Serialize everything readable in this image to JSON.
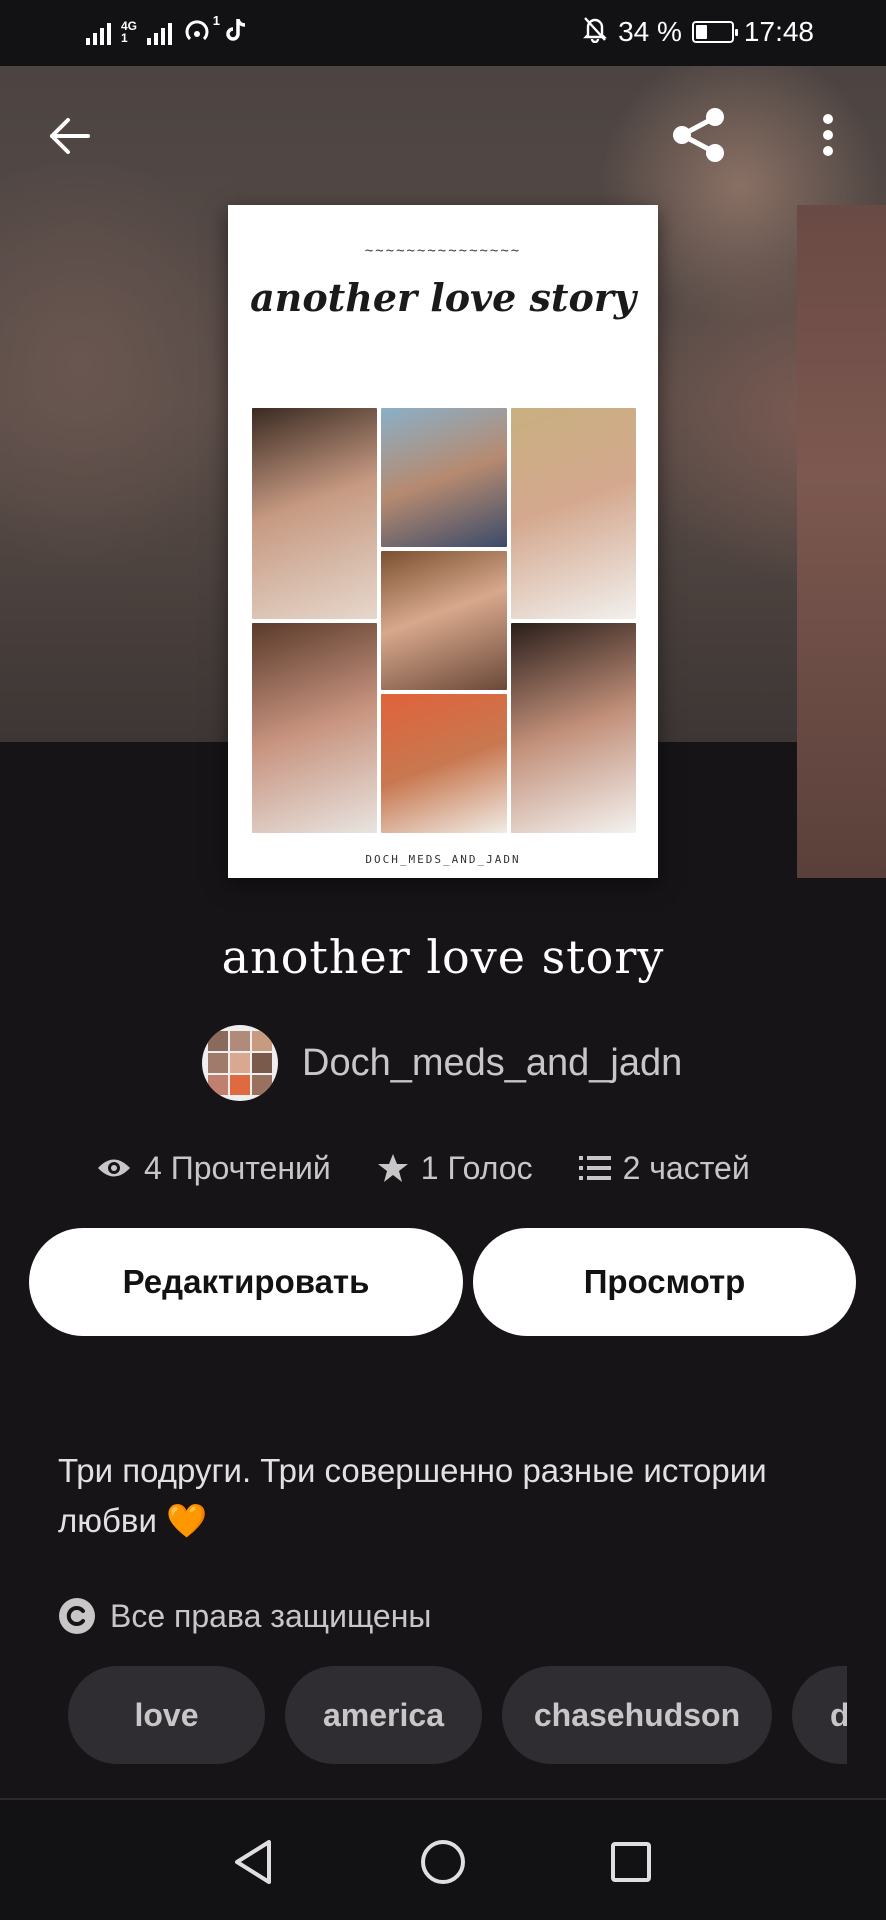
{
  "status_bar": {
    "network_label_top": "4G",
    "network_label_bottom": "1",
    "hotspot_badge": "1",
    "battery_text": "34 %",
    "battery_level_percent": 34,
    "time": "17:48"
  },
  "toolbar": {
    "back_icon": "arrow-left-icon",
    "share_icon": "share-icon",
    "more_icon": "more-vertical-icon"
  },
  "cover": {
    "decoration": "~~~~~~~~~~~~~~~",
    "title": "another love story",
    "author": "DOCH_MEDS_AND_JADN"
  },
  "book": {
    "title": "another love story",
    "author": "Doch_meds_and_jadn"
  },
  "stats": {
    "reads": "4 Прочтений",
    "votes": "1 Голос",
    "parts": "2 частей"
  },
  "actions": {
    "edit_label": "Редактировать",
    "view_label": "Просмотр"
  },
  "description": {
    "text": "Три подруги. Три совершенно разные истории любви",
    "emoji": "🧡"
  },
  "copyright": {
    "label": "Все права защищены"
  },
  "tags": [
    "love",
    "america",
    "chasehudson",
    "d"
  ],
  "colors": {
    "background": "#161417",
    "button_bg": "#ffffff",
    "tag_bg": "#2f2d31",
    "secondary_text": "#c9c6c8",
    "heart": "#f7941d"
  }
}
